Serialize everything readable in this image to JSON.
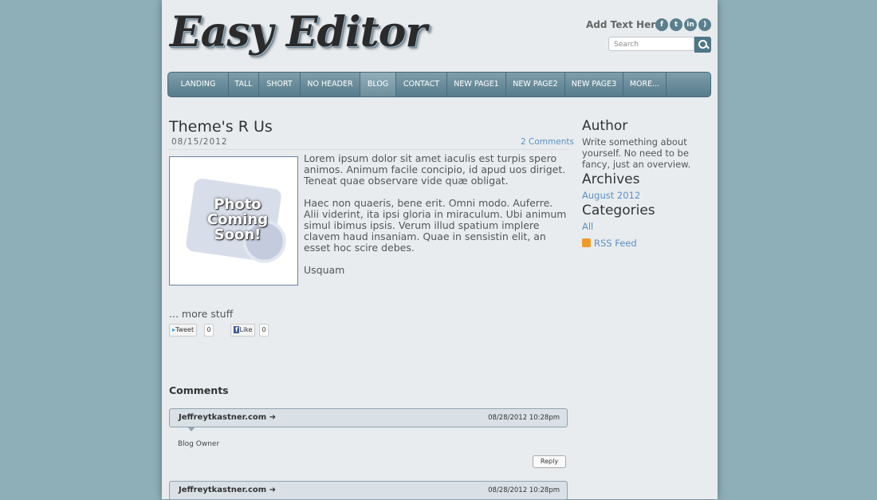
{
  "header": {
    "logo": "Easy Editor",
    "add_text": "Add Text Here",
    "social_icons": [
      "facebook-icon",
      "twitter-icon",
      "linkedin-icon",
      "rss-icon"
    ],
    "search_placeholder": "Search"
  },
  "nav": {
    "items": [
      "LANDING",
      "TALL",
      "SHORT",
      "NO HEADER",
      "BLOG",
      "CONTACT",
      "NEW PAGE1",
      "NEW PAGE2",
      "NEW PAGE3",
      "MORE..."
    ],
    "active": "BLOG"
  },
  "post": {
    "title": "Theme's R Us",
    "date": "08/15/2012",
    "comments_link": "2 Comments",
    "photo_text": [
      "Photo",
      "Coming",
      "Soon!"
    ],
    "paragraphs": [
      "Lorem ipsum dolor sit amet iaculis est turpis spero animos. Animum facile concipio, id apud uos diriget. Teneat quae observare vide quæ obligat.",
      "Haec non quaeris, bene erit. Omni modo. Auferre. Alii viderint, ita ipsi gloria in miraculum. Ubi animum simul ibimus ipsis. Verum illud spatium implere clavem haud insaniam. Quae in sensistin elit, an esset hoc scire debes.",
      "Usquam"
    ],
    "more": "... more stuff",
    "tweet_label": "Tweet",
    "tweet_count": "0",
    "like_label": "Like",
    "like_count": "0"
  },
  "comments": {
    "heading": "Comments",
    "items": [
      {
        "author": "Jeffreytkastner.com",
        "date": "08/28/2012 10:28pm",
        "text": "Blog Owner",
        "reply": "Reply"
      },
      {
        "author": "Jeffreytkastner.com",
        "date": "08/28/2012 10:28pm"
      }
    ]
  },
  "sidebar": {
    "author_heading": "Author",
    "author_text": "Write something about yourself. No need to be fancy, just an overview.",
    "archives_heading": "Archives",
    "archives_link": "August 2012",
    "categories_heading": "Categories",
    "categories_link": "All",
    "rss_link": "RSS Feed"
  },
  "colors": {
    "background": "#8fafb8",
    "page": "#e8ecef",
    "nav": "#6a8d9b",
    "link": "#5c8fc3"
  }
}
